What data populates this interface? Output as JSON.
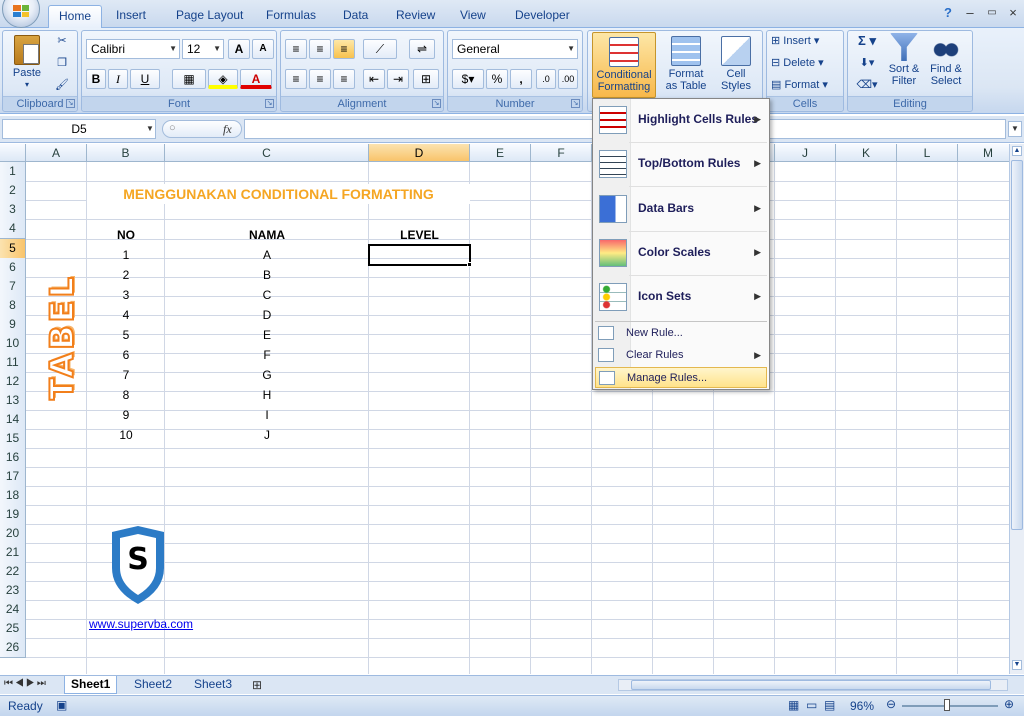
{
  "tabs": [
    "Home",
    "Insert",
    "Page Layout",
    "Formulas",
    "Data",
    "Review",
    "View",
    "Developer"
  ],
  "ribbon": {
    "clipboard": {
      "label": "Clipboard",
      "paste": "Paste"
    },
    "font": {
      "label": "Font",
      "name": "Calibri",
      "size": "12",
      "grow": "A",
      "shrink": "A",
      "bold": "B",
      "italic": "I",
      "underline": "U",
      "font_color_letter": "A"
    },
    "alignment": {
      "label": "Alignment"
    },
    "number": {
      "label": "Number",
      "format": "General",
      "percent": "%",
      "comma": ","
    },
    "styles": {
      "conditional_formatting": [
        "Conditional",
        "Formatting"
      ],
      "format_as_table": [
        "Format",
        "as Table"
      ],
      "cell_styles": [
        "Cell",
        "Styles"
      ]
    },
    "cells": {
      "label": "Cells",
      "insert": "Insert",
      "delete": "Delete",
      "format": "Format"
    },
    "editing": {
      "label": "Editing",
      "sort_filter": [
        "Sort &",
        "Filter"
      ],
      "find_select": [
        "Find &",
        "Select"
      ],
      "sigma": "Σ"
    }
  },
  "formula_bar": {
    "name_box": "D5",
    "fx": "fx",
    "formula": ""
  },
  "columns": [
    "A",
    "B",
    "C",
    "D",
    "E",
    "F",
    "G",
    "H",
    "I",
    "J",
    "K",
    "L",
    "M"
  ],
  "rows": [
    "1",
    "2",
    "3",
    "4",
    "5",
    "6",
    "7",
    "8",
    "9",
    "10",
    "11",
    "12",
    "13",
    "14",
    "15",
    "16",
    "17",
    "18",
    "19",
    "20",
    "21",
    "22",
    "23",
    "24",
    "25",
    "26"
  ],
  "sheet": {
    "title": "MENGGUNAKAN CONDITIONAL FORMATTING",
    "headers": {
      "no": "NO",
      "nama": "NAMA",
      "level": "LEVEL"
    },
    "no_values": [
      "1",
      "2",
      "3",
      "4",
      "5",
      "6",
      "7",
      "8",
      "9",
      "10"
    ],
    "nama_values": [
      "A",
      "B",
      "C",
      "D",
      "E",
      "F",
      "G",
      "H",
      "I",
      "J"
    ],
    "side_label": "TABEL",
    "logo_letter": "S",
    "link": "www.supervba.com",
    "title_color": "#f5a623",
    "side_label_color": "#f27f1b"
  },
  "menu": {
    "big_items": [
      "Highlight Cells Rules",
      "Top/Bottom Rules",
      "Data Bars",
      "Color Scales",
      "Icon Sets"
    ],
    "small_items": [
      "New Rule...",
      "Clear Rules",
      "Manage Rules..."
    ]
  },
  "sheet_tabs": [
    "Sheet1",
    "Sheet2",
    "Sheet3"
  ],
  "status": {
    "ready": "Ready",
    "zoom": "96%"
  }
}
